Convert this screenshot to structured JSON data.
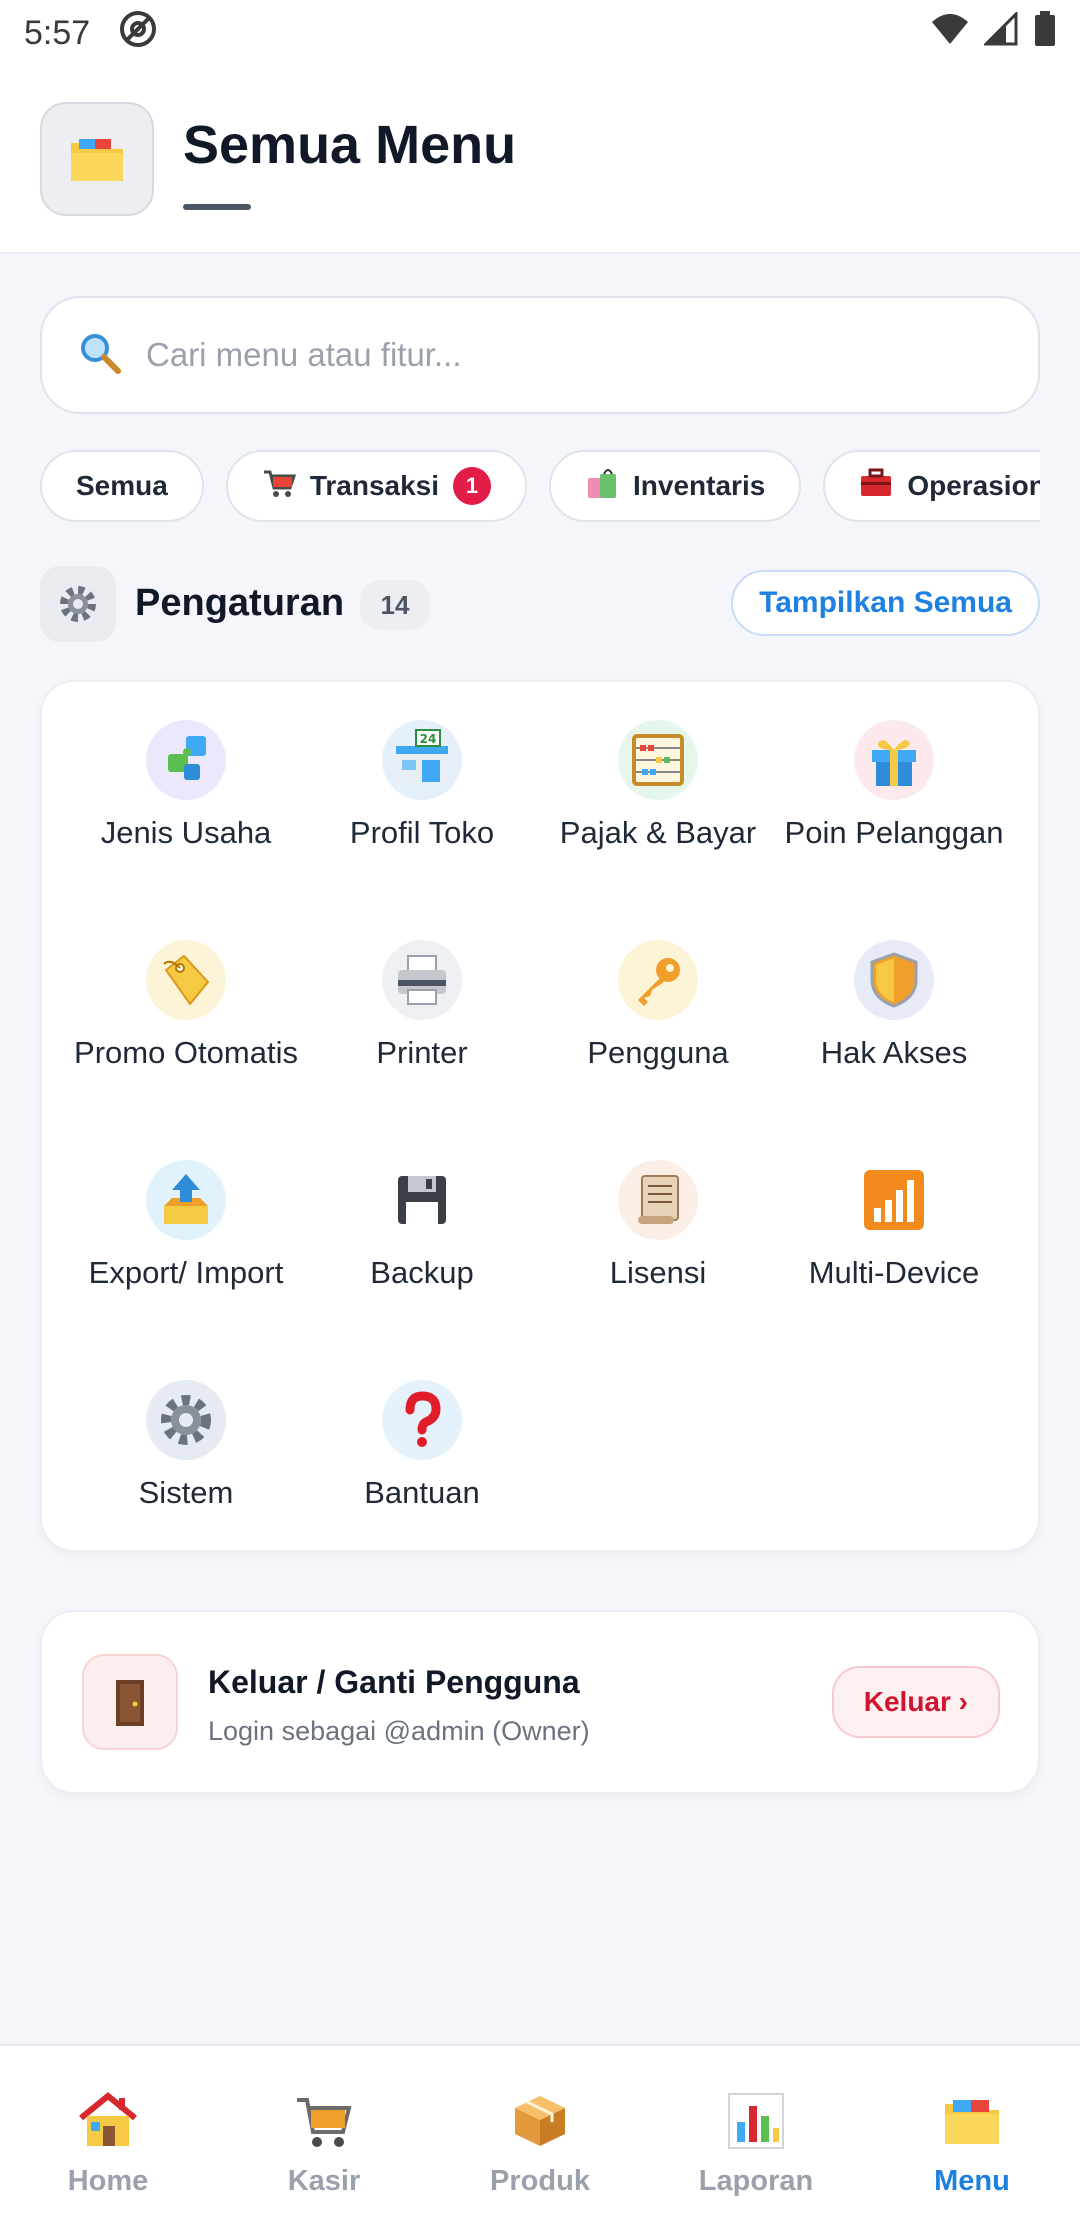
{
  "status_bar": {
    "time": "5:57"
  },
  "header": {
    "title": "Semua Menu"
  },
  "search": {
    "placeholder": "Cari menu atau fitur..."
  },
  "chips": [
    {
      "label": "Semua"
    },
    {
      "label": "Transaksi",
      "badge": "1"
    },
    {
      "label": "Inventaris"
    },
    {
      "label": "Operasional"
    }
  ],
  "section": {
    "title": "Pengaturan",
    "count": "14",
    "show_all_label": "Tampilkan Semua"
  },
  "menu_items": [
    {
      "label": "Jenis Usaha",
      "icon": "puzzle-icon"
    },
    {
      "label": "Profil Toko",
      "icon": "store-icon"
    },
    {
      "label": "Pajak & Bayar",
      "icon": "abacus-icon"
    },
    {
      "label": "Poin Pelanggan",
      "icon": "gift-icon"
    },
    {
      "label": "Promo Otomatis",
      "icon": "tag-icon"
    },
    {
      "label": "Printer",
      "icon": "printer-icon"
    },
    {
      "label": "Pengguna",
      "icon": "key-icon"
    },
    {
      "label": "Hak Akses",
      "icon": "shield-icon"
    },
    {
      "label": "Export/ Import",
      "icon": "export-icon"
    },
    {
      "label": "Backup",
      "icon": "floppy-icon"
    },
    {
      "label": "Lisensi",
      "icon": "scroll-icon"
    },
    {
      "label": "Multi-Device",
      "icon": "signal-icon"
    },
    {
      "label": "Sistem",
      "icon": "gear-icon"
    },
    {
      "label": "Bantuan",
      "icon": "question-icon"
    }
  ],
  "logout": {
    "title": "Keluar / Ganti Pengguna",
    "subtitle": "Login sebagai @admin (Owner)",
    "button_label": "Keluar ›"
  },
  "bottom_nav": [
    {
      "label": "Home",
      "icon": "house-icon"
    },
    {
      "label": "Kasir",
      "icon": "cart-icon"
    },
    {
      "label": "Produk",
      "icon": "package-icon"
    },
    {
      "label": "Laporan",
      "icon": "chart-icon"
    },
    {
      "label": "Menu",
      "icon": "folder-icon",
      "active": true
    }
  ],
  "colors": {
    "accent": "#1e80e0",
    "danger": "#d1142f",
    "background": "#f4f6fb"
  }
}
